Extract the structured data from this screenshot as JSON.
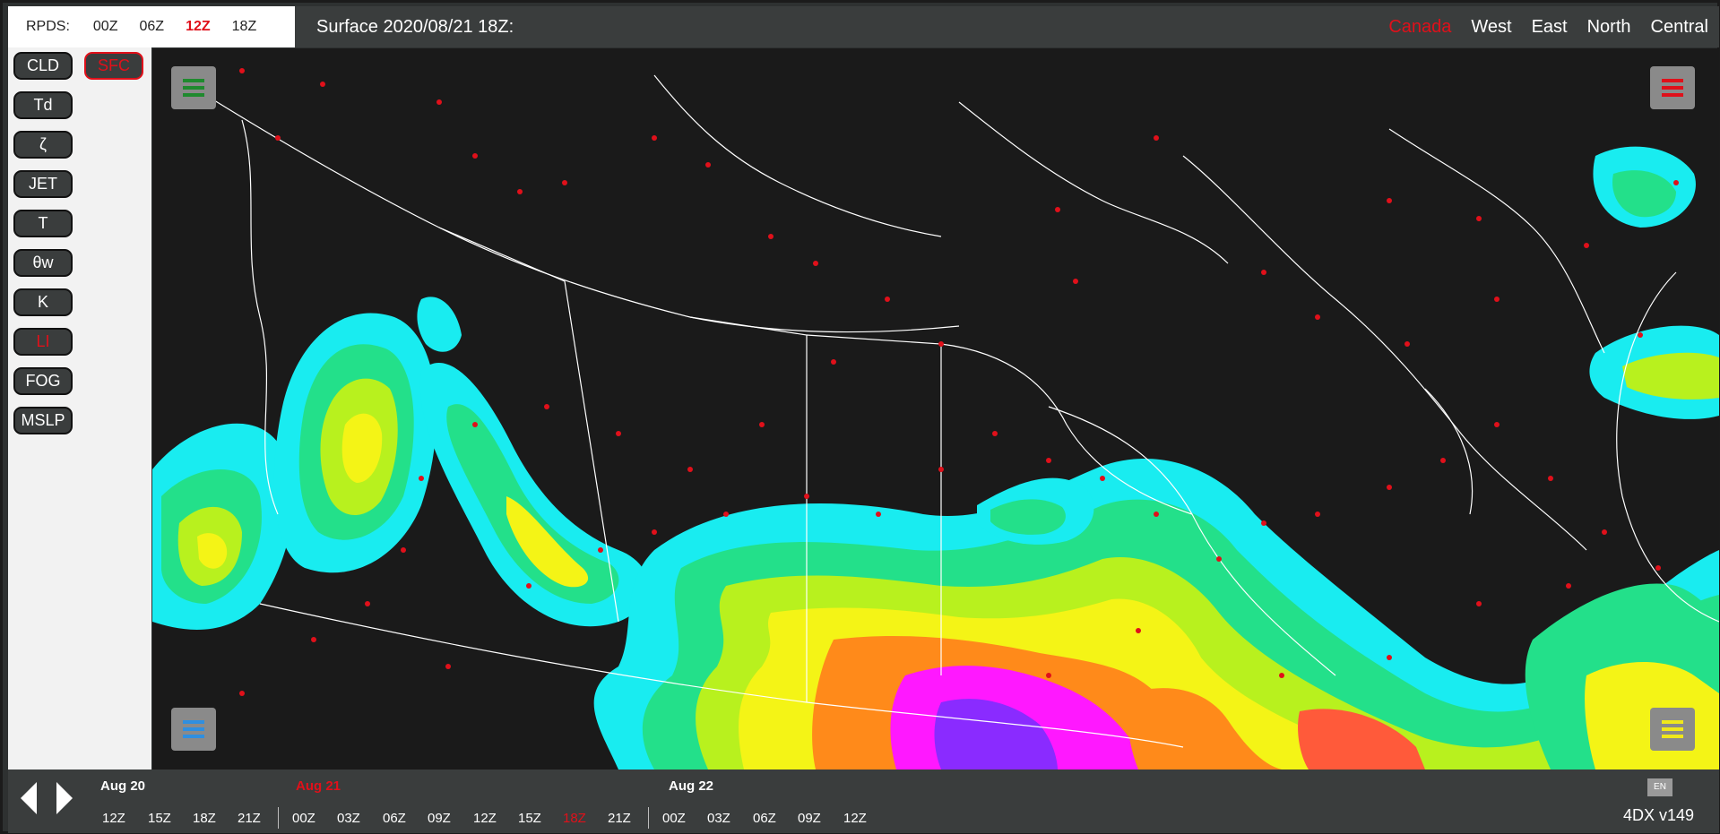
{
  "runs": {
    "label": "RPDS:",
    "items": [
      "00Z",
      "06Z",
      "12Z",
      "18Z"
    ],
    "active": "12Z"
  },
  "header": {
    "title": "Surface 2020/08/21 18Z:",
    "regions": [
      "Canada",
      "West",
      "East",
      "North",
      "Central"
    ],
    "active_region": "Canada"
  },
  "products": {
    "left": [
      "CLD",
      "Td",
      "ζ",
      "JET",
      "T",
      "θw",
      "K",
      "LI",
      "FOG",
      "MSLP"
    ],
    "right": [
      "SFC"
    ],
    "active": [
      "LI",
      "SFC"
    ]
  },
  "map_controls": {
    "top_left_menu_color": "#1f8a2e",
    "top_right_menu_color": "#e0101a",
    "bottom_left_menu_color": "#2f8fe0",
    "bottom_right_menu_color": "#f0e81a"
  },
  "timeline": {
    "days": [
      "Aug 20",
      "Aug 21",
      "Aug 22"
    ],
    "active_day": "Aug 21",
    "aug20": [
      "12Z",
      "15Z",
      "18Z",
      "21Z"
    ],
    "aug21": [
      "00Z",
      "03Z",
      "06Z",
      "09Z",
      "12Z",
      "15Z",
      "18Z",
      "21Z"
    ],
    "aug22": [
      "00Z",
      "03Z",
      "06Z",
      "09Z",
      "12Z"
    ],
    "active_time": "18Z"
  },
  "footer": {
    "lang": "EN",
    "version": "4DX v149"
  },
  "colors": {
    "accent": "#e0101a",
    "bar": "#3a3d3d",
    "map_bg": "#1a1a1a",
    "cyan": "#19ecf0",
    "green": "#23e08a",
    "yellow": "#f4f416",
    "orange": "#ff8a1a",
    "magenta": "#ff18ff",
    "purple": "#8a2bff"
  }
}
